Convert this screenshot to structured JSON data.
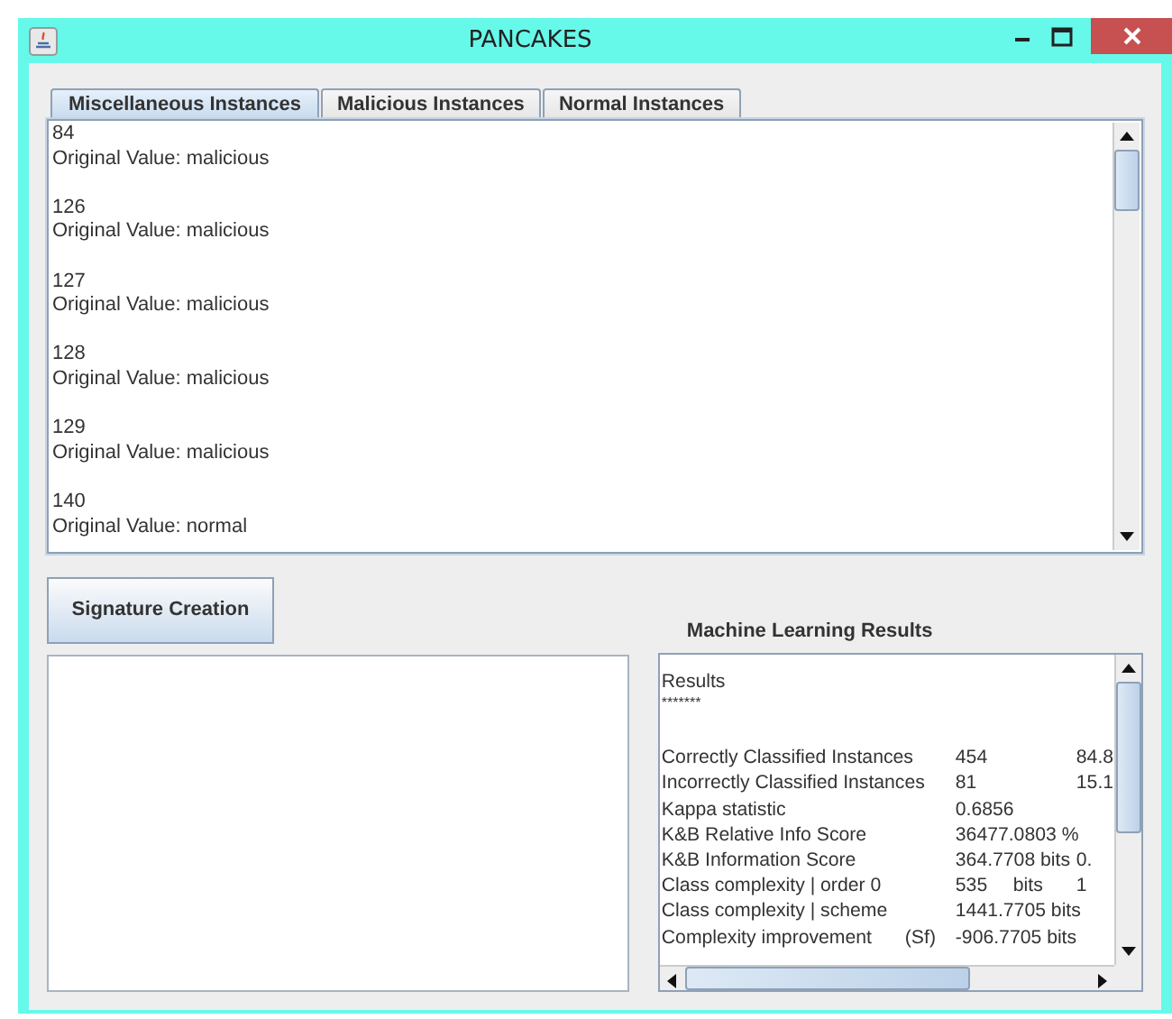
{
  "window": {
    "title": "PANCAKES"
  },
  "tabs": [
    {
      "label": "Miscellaneous Instances",
      "selected": true
    },
    {
      "label": "Malicious Instances",
      "selected": false
    },
    {
      "label": "Normal Instances",
      "selected": false
    }
  ],
  "instances": [
    {
      "id": "84",
      "original_value": "Original Value: malicious"
    },
    {
      "id": "126",
      "original_value": "Original Value: malicious"
    },
    {
      "id": "127",
      "original_value": "Original Value: malicious"
    },
    {
      "id": "128",
      "original_value": "Original Value: malicious"
    },
    {
      "id": "129",
      "original_value": "Original Value: malicious"
    },
    {
      "id": "140",
      "original_value": "Original Value: normal"
    }
  ],
  "signature_button": {
    "label": "Signature Creation"
  },
  "results_panel": {
    "title": "Machine Learning Results",
    "header": "Results",
    "underline": "*******",
    "rows": [
      {
        "label": "Correctly Classified Instances",
        "value": "454",
        "extra": "84.8"
      },
      {
        "label": "Incorrectly Classified Instances",
        "value": "81",
        "extra": "15.1"
      },
      {
        "label": "Kappa statistic",
        "value": "0.6856"
      },
      {
        "label": "K&B Relative Info Score",
        "value": "36477.0803 %"
      },
      {
        "label": "K&B Information Score",
        "value": "364.7708 bits",
        "extra": "0."
      },
      {
        "label": "Class complexity | order 0",
        "value": "535",
        "unit": "bits",
        "extra": "1"
      },
      {
        "label": "Class complexity | scheme",
        "value": "1441.7705 bits"
      },
      {
        "label": "Complexity improvement",
        "note": "(Sf)",
        "value": "-906.7705 bits"
      }
    ]
  }
}
